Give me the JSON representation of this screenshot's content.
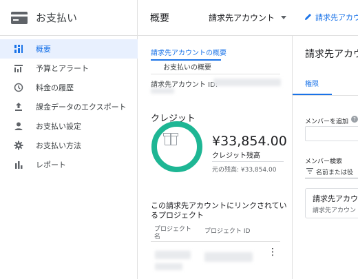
{
  "sidebar": {
    "title": "お支払い",
    "items": [
      {
        "label": "概要",
        "icon": "dashboard-icon",
        "active": true
      },
      {
        "label": "予算とアラート",
        "icon": "budget-chart-icon",
        "active": false
      },
      {
        "label": "料金の履歴",
        "icon": "clock-icon",
        "active": false
      },
      {
        "label": "課金データのエクスポート",
        "icon": "upload-icon",
        "active": false
      },
      {
        "label": "お支払い設定",
        "icon": "person-icon",
        "active": false
      },
      {
        "label": "お支払い方法",
        "icon": "gear-icon",
        "active": false
      },
      {
        "label": "レポート",
        "icon": "bar-chart-icon",
        "active": false
      }
    ]
  },
  "header": {
    "title": "概要",
    "account_selector": "請求先アカウント",
    "edit_link": "請求先アカウ"
  },
  "overview": {
    "tabs": {
      "account_overview": "請求先アカウントの概要",
      "payment_overview": "お支払いの概要"
    },
    "account_id_label": "請求先アカウント ID:",
    "credit": {
      "title": "クレジット",
      "amount": "¥33,854.00",
      "remaining_label": "クレジット残高",
      "original_amount": "元の残高: ¥33,854.00"
    },
    "projects": {
      "title": "この請求先アカウントにリンクされているプロジェクト",
      "columns": [
        "プロジェクト名",
        "プロジェクト ID"
      ]
    }
  },
  "permissions_panel": {
    "title": "請求先アカウ",
    "tab": "権限",
    "add_member_label": "メンバーを追加",
    "search_label": "メンバー検索",
    "search_placeholder": "名前または役",
    "card_title": "請求先アカウ",
    "card_subtitle": "請求先アカウン"
  },
  "colors": {
    "accent": "#1a73e8",
    "credit_ring": "#1eb694",
    "active_nav_bg": "#e8f0fe"
  }
}
